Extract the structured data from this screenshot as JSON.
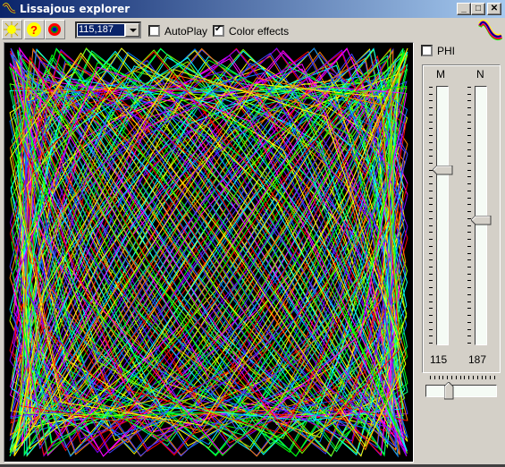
{
  "window": {
    "title": "Lissajous explorer",
    "controls": {
      "minimize": "_",
      "maximize": "□",
      "close": "✕"
    }
  },
  "toolbar": {
    "buttons": [
      {
        "name": "sun-icon",
        "tooltip": ""
      },
      {
        "name": "help-icon",
        "tooltip": ""
      },
      {
        "name": "target-icon",
        "tooltip": ""
      }
    ],
    "preset_combo": {
      "value": "115,187"
    },
    "autoplay": {
      "label": "AutoPlay",
      "checked": false
    },
    "color_effects": {
      "label": "Color effects",
      "checked": true
    }
  },
  "side_panel": {
    "phi": {
      "label": "PHI",
      "checked": false
    },
    "slider_m": {
      "label": "M",
      "value": "115",
      "position_fraction": 0.32
    },
    "slider_n": {
      "label": "N",
      "value": "187",
      "position_fraction": 0.52
    },
    "phase_slider": {
      "position_fraction": 0.3
    }
  },
  "plot": {
    "m": 115,
    "n": 187,
    "colors": [
      "#ff0000",
      "#ff8000",
      "#ffff00",
      "#80ff00",
      "#00ff00",
      "#00ff80",
      "#00ffff",
      "#0080ff",
      "#4040ff",
      "#8000ff",
      "#ff00ff"
    ]
  }
}
